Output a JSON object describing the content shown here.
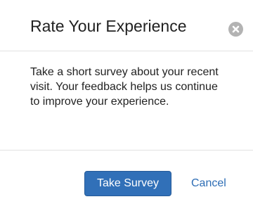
{
  "dialog": {
    "title": "Rate Your Experience",
    "close_icon": "close-circle-icon",
    "message": "Take a short survey about your recent visit. Your feedback helps us continue to improve your experience.",
    "primary_button_label": "Take Survey",
    "cancel_label": "Cancel"
  },
  "colors": {
    "primary_button": "#3170b8",
    "link": "#2d6db5",
    "close_icon": "#b3b3b3",
    "divider": "#e2e2e2"
  }
}
